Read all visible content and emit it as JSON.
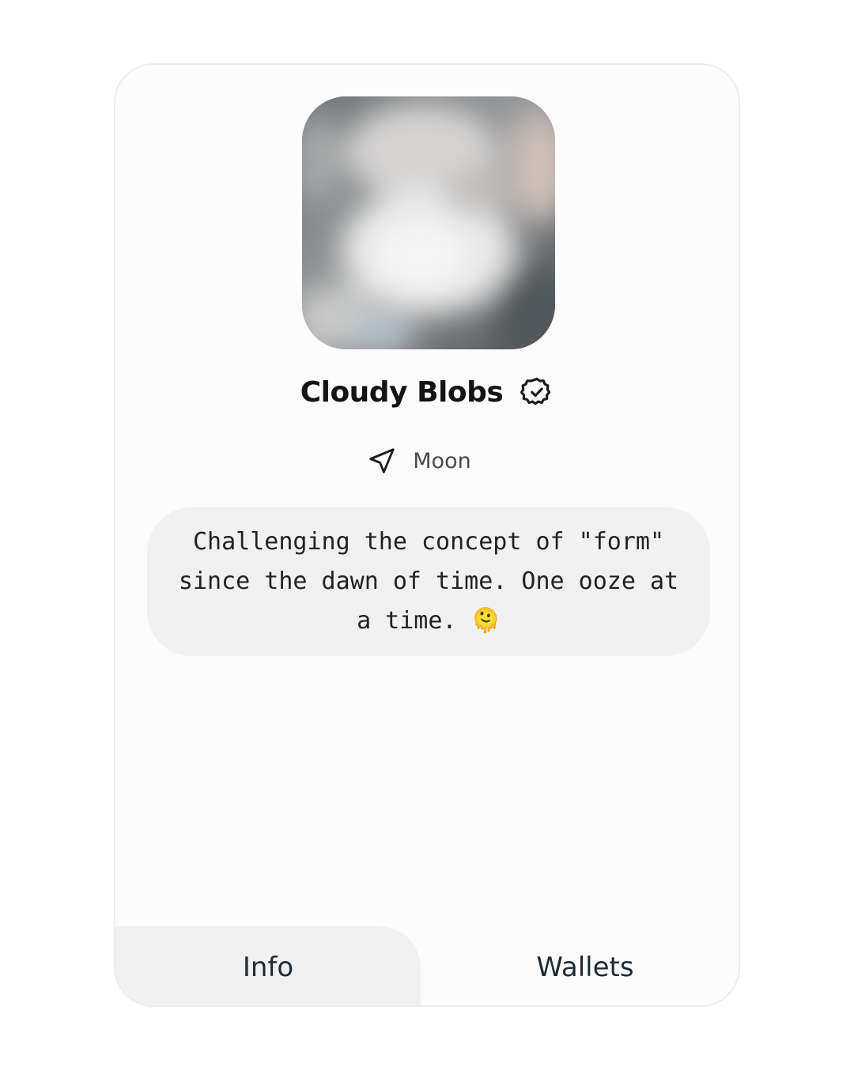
{
  "profile": {
    "name": "Cloudy Blobs",
    "location": "Moon",
    "bio": "Challenging the concept of \"form\" since the dawn of time. One ooze at a time. 🫠",
    "bio_emoji_icon": "melting-blob-icon",
    "verified_icon": "verified-check-icon",
    "location_icon": "navigation-arrow-icon"
  },
  "tabs": [
    {
      "label": "Info",
      "active": true
    },
    {
      "label": "Wallets",
      "active": false
    }
  ],
  "colors": {
    "card_border": "#f1ebe8",
    "pill_background": "#f1f1f1",
    "text_dark": "#141414",
    "emoji_yellow": "#f5b731"
  }
}
